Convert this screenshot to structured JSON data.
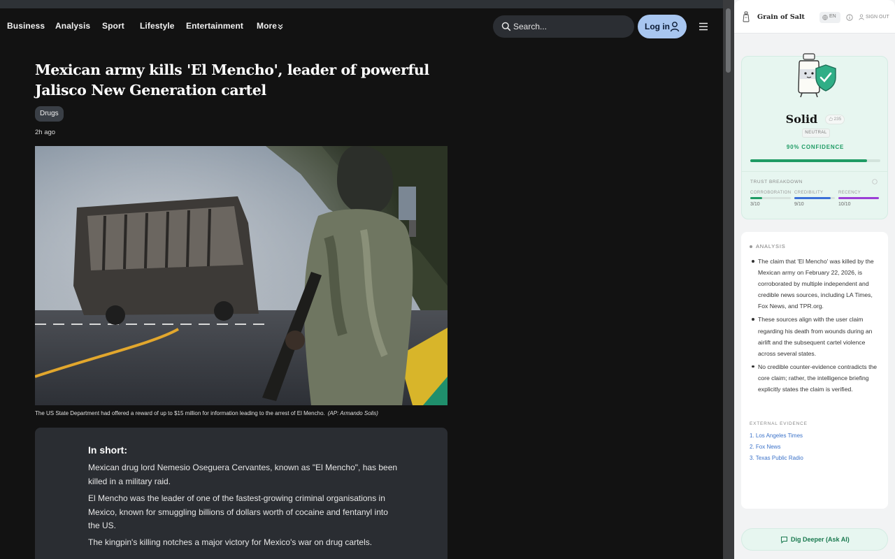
{
  "nav": {
    "links": [
      "Business",
      "Analysis",
      "Sport",
      "Lifestyle",
      "Entertainment",
      "More"
    ],
    "search_placeholder": "Search...",
    "login_label": "Log in",
    "icons": {
      "search": "search-icon",
      "login": "user-icon",
      "menu": "hamburger-menu-icon",
      "more": "chevron-down-icon"
    }
  },
  "article": {
    "headline": "Mexican army kills 'El Mencho', leader of powerful Jalisco New Generation cartel",
    "tag": "Drugs",
    "time": "2h ago",
    "caption": "The US State Department had offered a reward of up to $15 million for information leading to the arrest of El Mencho.",
    "caption_credit": "(AP: Armando Solis)",
    "summary": {
      "title": "In short:",
      "paragraphs": [
        "Mexican drug lord Nemesio Oseguera Cervantes, known as \"El Mencho\", has been killed in a military raid.",
        "El Mencho was the leader of one of the fastest-growing criminal organisations in Mexico, known for smuggling billions of dollars worth of cocaine and fentanyl into the US.",
        "The kingpin's killing notches a major victory for Mexico's war on drug cartels."
      ]
    }
  },
  "panel": {
    "brand": "Grain of Salt",
    "lang": "EN",
    "signout": "SIGN OUT",
    "verdict": "Solid",
    "votes": "235",
    "stance": "NEUTRAL",
    "confidence_text": "90% CONFIDENCE",
    "confidence_value": 0.9,
    "breakdown_title": "TRUST BREAKDOWN",
    "metrics": [
      {
        "label": "CORROBORATION",
        "value_text": "3/10",
        "value": 3,
        "color": "#1e9b64"
      },
      {
        "label": "CREDIBILITY",
        "value_text": "9/10",
        "value": 9,
        "color": "#3b6fd8"
      },
      {
        "label": "RECENCY",
        "value_text": "10/10",
        "value": 10,
        "color": "#9b3fd6"
      }
    ],
    "analysis_title": "ANALYSIS",
    "analysis": [
      "The claim that 'El Mencho' was killed by the Mexican army on February 22, 2026, is corroborated by multiple independent and credible news sources, including LA Times, Fox News, and TPR.org.",
      "These sources align with the user claim regarding his death from wounds during an airlift and the subsequent cartel violence across several states.",
      "No credible counter-evidence contradicts the core claim; rather, the intelligence briefing explicitly states the claim is verified."
    ],
    "evidence_title": "EXTERNAL EVIDENCE",
    "evidence": [
      "1. Los Angeles Times",
      "2. Fox News",
      "3. Texas Public Radio"
    ],
    "deeper_label": "Dig Deeper (Ask AI)",
    "colors": {
      "accent": "#1e9b64",
      "link": "#3b72c9",
      "card": "#e7f6f0"
    }
  }
}
